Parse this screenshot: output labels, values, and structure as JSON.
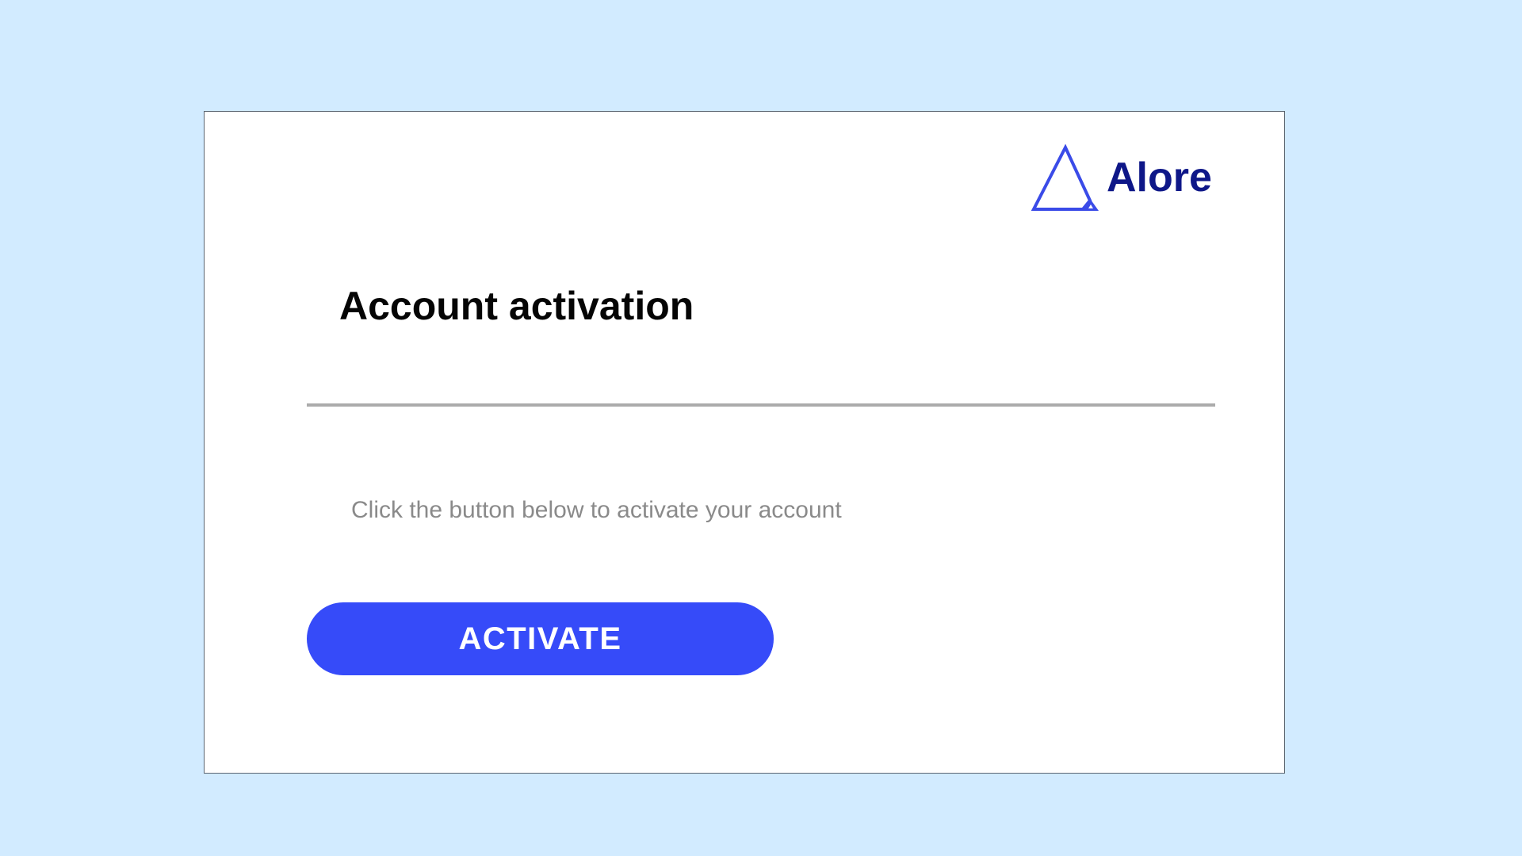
{
  "brand": {
    "name": "Alore",
    "logo_icon": "triangle-logo-icon",
    "text_color": "#0e1788",
    "icon_color": "#3a4be8"
  },
  "activation": {
    "title": "Account activation",
    "instructions": "Click the button below to activate your account",
    "button_label": "ACTIVATE"
  },
  "colors": {
    "page_background": "#d2ebff",
    "card_background": "#ffffff",
    "button_background": "#364bf9",
    "button_text": "#ffffff",
    "divider": "#ababab",
    "instruction_text": "#8a8a8a"
  }
}
